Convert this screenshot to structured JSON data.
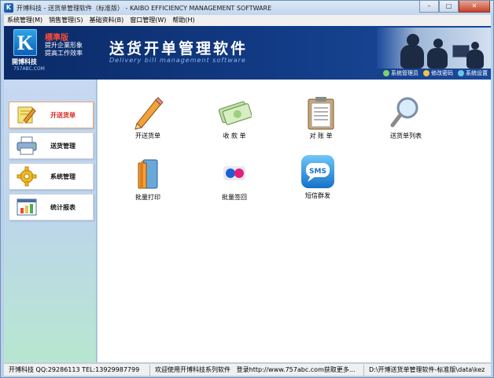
{
  "window": {
    "title": "开博科技 - 送货单管理软件（标准版） - KAIBO EFFICIENCY MANAGEMENT SOFTWARE",
    "controls": [
      "–",
      "□",
      "✕"
    ]
  },
  "menu": {
    "items": [
      "系统管理(M)",
      "销售管理(S)",
      "基础资料(B)",
      "窗口管理(W)",
      "帮助(H)"
    ]
  },
  "banner": {
    "logo_letter": "K",
    "company": "開博科技",
    "url": "757ABC.COM",
    "edition": "標準版",
    "slogan_line1": "提升企業形象",
    "slogan_line2": "提高工作效率",
    "title": "送货开单管理软件",
    "subtitle": "Delivery bill management software",
    "links": [
      {
        "label": "系统管理员",
        "icon": "user-icon",
        "color": "#7fd16a"
      },
      {
        "label": "修改密码",
        "icon": "pencil-icon",
        "color": "#f2c14a"
      },
      {
        "label": "系统设置",
        "icon": "gear-icon",
        "color": "#6ac4e8"
      }
    ]
  },
  "sidebar": {
    "items": [
      {
        "label": "开送货单",
        "icon": "pencil-notepad-icon",
        "active": true
      },
      {
        "label": "送货管理",
        "icon": "printer-icon",
        "active": false
      },
      {
        "label": "系统管理",
        "icon": "gear-icon",
        "active": false
      },
      {
        "label": "统计报表",
        "icon": "bar-chart-icon",
        "active": false
      }
    ]
  },
  "tiles": [
    {
      "label": "开送货单",
      "icon": "pencil-icon"
    },
    {
      "label": "收 款 单",
      "icon": "money-icon"
    },
    {
      "label": "对 账 单",
      "icon": "clipboard-icon"
    },
    {
      "label": "送货单列表",
      "icon": "magnifier-icon"
    },
    {
      "label": "批量打印",
      "icon": "folder-icon"
    },
    {
      "label": "批量签回",
      "icon": "dots-icon"
    },
    {
      "label": "短信群发",
      "icon": "sms-icon",
      "icon_text": "SMS"
    }
  ],
  "status": {
    "contact": "开博科技 QQ:29286113 TEL:13929987799",
    "welcome": "欢迎使用开博科技系列软件",
    "login": "登录http://www.757abc.com获取更多...",
    "path": "D:\\开博送货单管理软件-标准版\\data\\kez"
  }
}
